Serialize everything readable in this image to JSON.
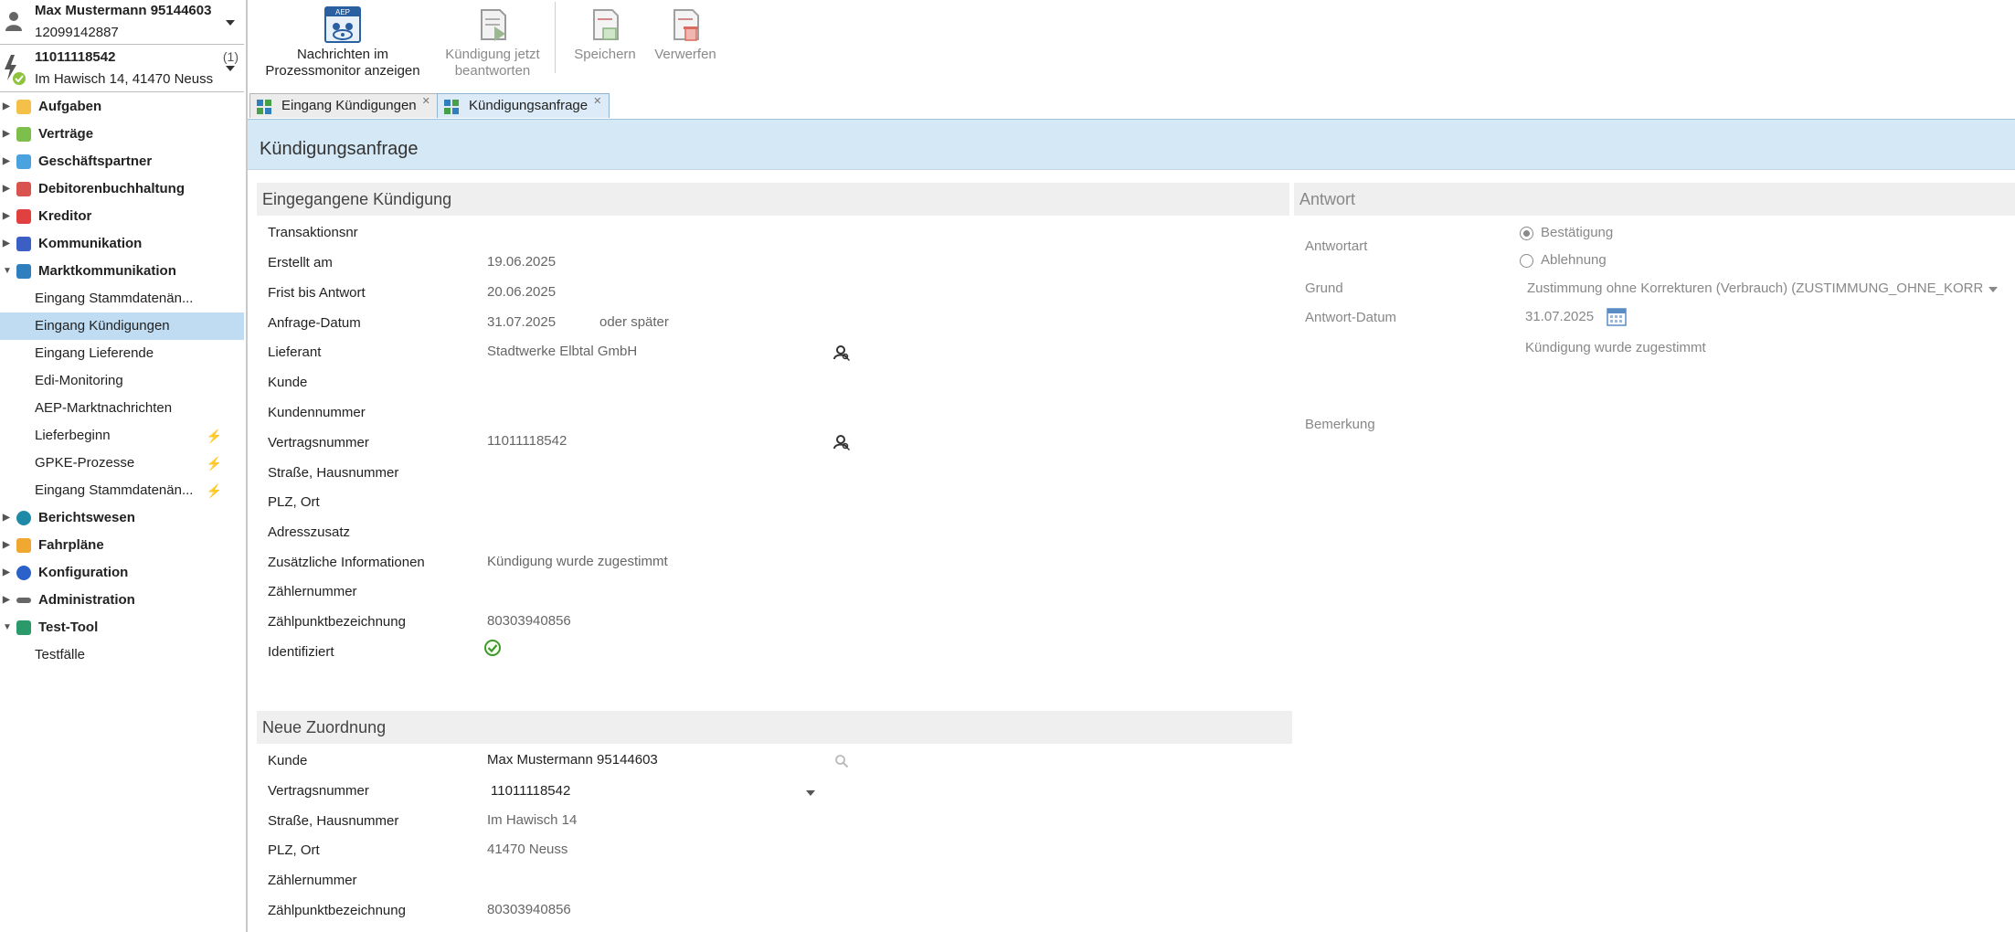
{
  "user": {
    "name": "Max Mustermann 95144603",
    "id": "12099142887"
  },
  "contract": {
    "id": "11011118542",
    "count": "(1)",
    "address": "Im Hawisch 14, 41470 Neuss"
  },
  "nav": {
    "items": [
      {
        "label": "Aufgaben"
      },
      {
        "label": "Verträge"
      },
      {
        "label": "Geschäftspartner"
      },
      {
        "label": "Debitorenbuchhaltung"
      },
      {
        "label": "Kreditor"
      },
      {
        "label": "Kommunikation"
      },
      {
        "label": "Marktkommunikation"
      },
      {
        "label": "Eingang Stammdatenän..."
      },
      {
        "label": "Eingang Kündigungen"
      },
      {
        "label": "Eingang Lieferende"
      },
      {
        "label": "Edi-Monitoring"
      },
      {
        "label": "AEP-Marktnachrichten"
      },
      {
        "label": "Lieferbeginn"
      },
      {
        "label": "GPKE-Prozesse"
      },
      {
        "label": "Eingang Stammdatenän..."
      },
      {
        "label": "Berichtswesen"
      },
      {
        "label": "Fahrpläne"
      },
      {
        "label": "Konfiguration"
      },
      {
        "label": "Administration"
      },
      {
        "label": "Test-Tool"
      },
      {
        "label": "Testfälle"
      }
    ]
  },
  "toolbar": {
    "monitor": {
      "line1": "Nachrichten im",
      "line2": "Prozessmonitor anzeigen",
      "icon_text": "AEP"
    },
    "answer": {
      "line1": "Kündigung jetzt",
      "line2": "beantworten"
    },
    "save": "Speichern",
    "discard": "Verwerfen"
  },
  "tabs": [
    {
      "label": "Eingang Kündigungen"
    },
    {
      "label": "Kündigungsanfrage"
    }
  ],
  "page": {
    "title": "Kündigungsanfrage"
  },
  "received": {
    "title": "Eingegangene Kündigung",
    "rows": [
      {
        "label": "Transaktionsnr",
        "value": ""
      },
      {
        "label": "Erstellt am",
        "value": "19.06.2025"
      },
      {
        "label": "Frist bis Antwort",
        "value": "20.06.2025"
      },
      {
        "label": "Anfrage-Datum",
        "value": "31.07.2025",
        "extra": "oder später"
      },
      {
        "label": "Lieferant",
        "value": "Stadtwerke Elbtal GmbH"
      },
      {
        "label": "Kunde",
        "value": ""
      },
      {
        "label": "Kundennummer",
        "value": ""
      },
      {
        "label": "Vertragsnummer",
        "value": "11011118542"
      },
      {
        "label": "Straße, Hausnummer",
        "value": ""
      },
      {
        "label": "PLZ, Ort",
        "value": ""
      },
      {
        "label": "Adresszusatz",
        "value": ""
      },
      {
        "label": "Zusätzliche Informationen",
        "value": "Kündigung wurde zugestimmt"
      },
      {
        "label": "Zählernummer",
        "value": ""
      },
      {
        "label": "Zählpunktbezeichnung",
        "value": "80303940856"
      },
      {
        "label": "Identifiziert",
        "value": ""
      }
    ]
  },
  "assignment": {
    "title": "Neue Zuordnung",
    "rows": [
      {
        "label": "Kunde",
        "value": "Max Mustermann 95144603"
      },
      {
        "label": "Vertragsnummer",
        "value": "11011118542"
      },
      {
        "label": "Straße, Hausnummer",
        "value": "Im Hawisch 14"
      },
      {
        "label": "PLZ, Ort",
        "value": "41470 Neuss"
      },
      {
        "label": "Zählernummer",
        "value": ""
      },
      {
        "label": "Zählpunktbezeichnung",
        "value": "80303940856"
      }
    ]
  },
  "answer": {
    "title": "Antwort",
    "type_label": "Antwortart",
    "option_confirm": "Bestätigung",
    "option_reject": "Ablehnung",
    "selected": "Bestätigung",
    "reason_label": "Grund",
    "reason_value": "Zustimmung ohne Korrekturen (Verbrauch) (ZUSTIMMUNG_OHNE_KORR",
    "date_label": "Antwort-Datum",
    "date_value": "31.07.2025",
    "note": "Kündigung wurde zugestimmt",
    "remark_label": "Bemerkung"
  },
  "colors": {
    "accent": "#d4e8f5",
    "selected_nav": "#bfdcf2",
    "ok_green": "#3d9a2a"
  }
}
